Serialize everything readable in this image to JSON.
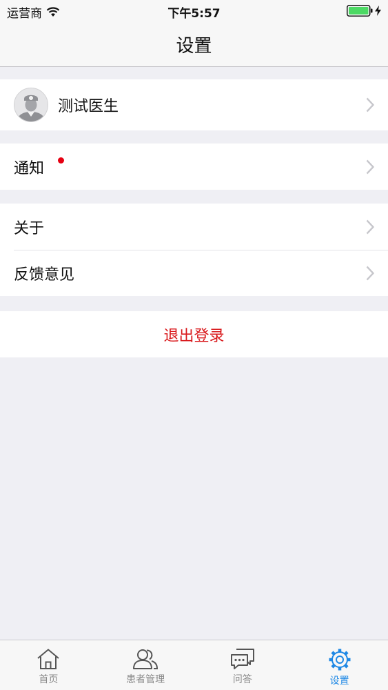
{
  "status_bar": {
    "carrier": "运营商",
    "time": "下午5:57"
  },
  "nav": {
    "title": "设置"
  },
  "profile": {
    "name": "测试医生"
  },
  "items": {
    "notifications": "通知",
    "about": "关于",
    "feedback": "反馈意见"
  },
  "logout_label": "退出登录",
  "tabs": [
    {
      "label": "首页",
      "icon": "home-icon"
    },
    {
      "label": "患者管理",
      "icon": "patients-icon"
    },
    {
      "label": "问答",
      "icon": "chat-icon"
    },
    {
      "label": "设置",
      "icon": "gear-icon",
      "active": true
    }
  ],
  "colors": {
    "accent": "#1e88e5",
    "danger": "#d9191c",
    "badge": "#e60012",
    "background": "#efeff4"
  }
}
